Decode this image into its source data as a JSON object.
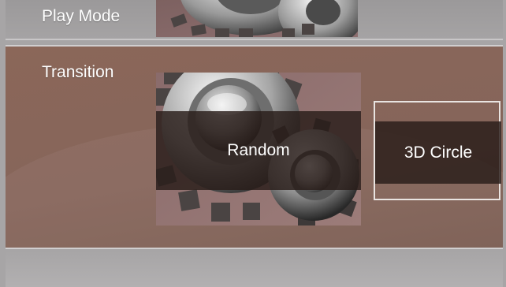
{
  "settings": {
    "play_mode_label": "Play Mode",
    "transition_label": "Transition",
    "transition_options": [
      "Random",
      "3D Circle"
    ],
    "selected_option": "3D Circle"
  },
  "colors": {
    "panel_gray": "#a7a5a6",
    "transition_bg": "#86655a",
    "option_band": "#2a1c18",
    "highlight_border": "#e9e4e1"
  },
  "icons": [
    "gears-thumbnail-icon"
  ]
}
